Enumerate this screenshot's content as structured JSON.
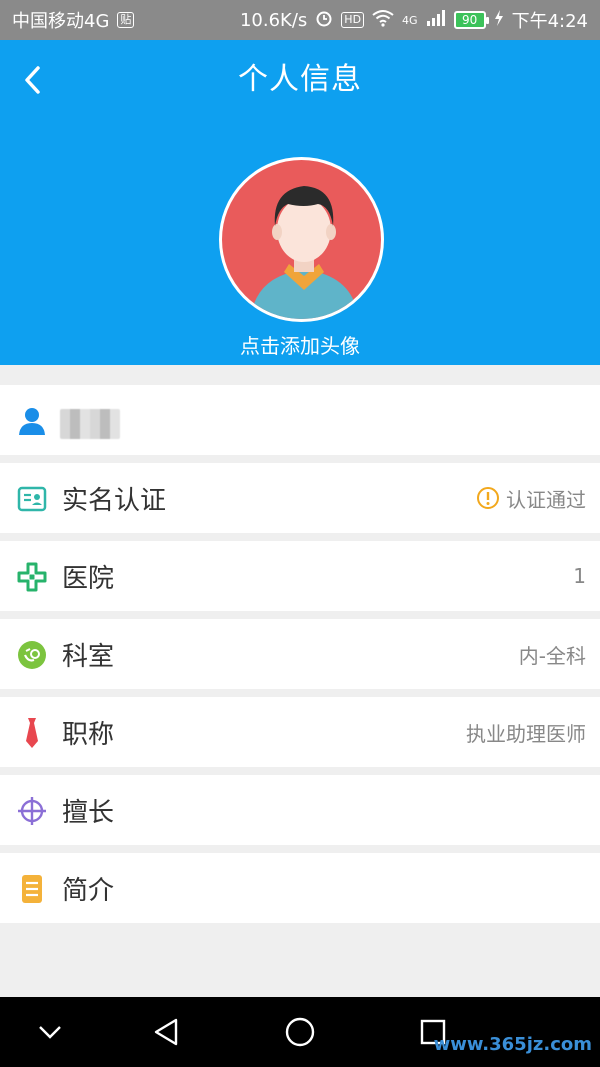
{
  "status_bar": {
    "carrier": "中国移动4G",
    "sim_badge": "贴",
    "speed": "10.6K/s",
    "hd_badge": "HD",
    "net_type": "4G",
    "battery": "90",
    "time": "下午4:24"
  },
  "header": {
    "title": "个人信息",
    "avatar_caption": "点击添加头像",
    "background_color": "#0ea0f0"
  },
  "rows": [
    {
      "label": "",
      "value": "",
      "icon": "user-icon",
      "name_redacted": true
    },
    {
      "label": "实名认证",
      "value": "认证通过",
      "icon": "id-card-icon",
      "status_icon": "warning-icon"
    },
    {
      "label": "医院",
      "value": "1",
      "icon": "hospital-icon"
    },
    {
      "label": "科室",
      "value": "内-全科",
      "icon": "department-icon"
    },
    {
      "label": "职称",
      "value": "执业助理医师",
      "icon": "tie-icon"
    },
    {
      "label": "擅长",
      "value": "",
      "icon": "target-icon"
    },
    {
      "label": "简介",
      "value": "",
      "icon": "document-icon"
    }
  ],
  "nav_bar": {
    "buttons": [
      "collapse-icon",
      "back-icon",
      "home-icon",
      "recents-icon"
    ]
  },
  "watermark": "www.365jz.com"
}
